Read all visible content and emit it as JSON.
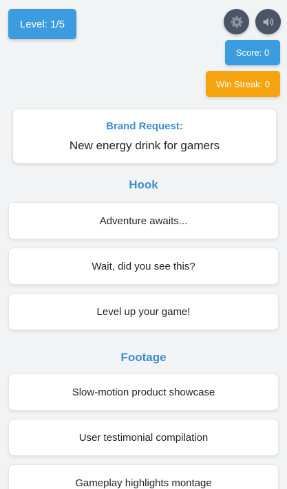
{
  "header": {
    "level_label": "Level: 1/5",
    "score_label": "Score: 0",
    "streak_label": "Win Streak: 0"
  },
  "icons": {
    "settings": "gear-icon",
    "sound": "speaker-icon"
  },
  "brand": {
    "label": "Brand Request:",
    "text": "New energy drink for gamers"
  },
  "sections": {
    "hook": {
      "title": "Hook",
      "options": [
        "Adventure awaits...",
        "Wait, did you see this?",
        "Level up your game!"
      ]
    },
    "footage": {
      "title": "Footage",
      "options": [
        "Slow-motion product showcase",
        "User testimonial compilation",
        "Gameplay highlights montage"
      ]
    }
  },
  "colors": {
    "accent_blue": "#3b9ddf",
    "streak_orange": "#f5a30f",
    "icon_button": "#4a5565",
    "background": "#f1f3f4"
  }
}
